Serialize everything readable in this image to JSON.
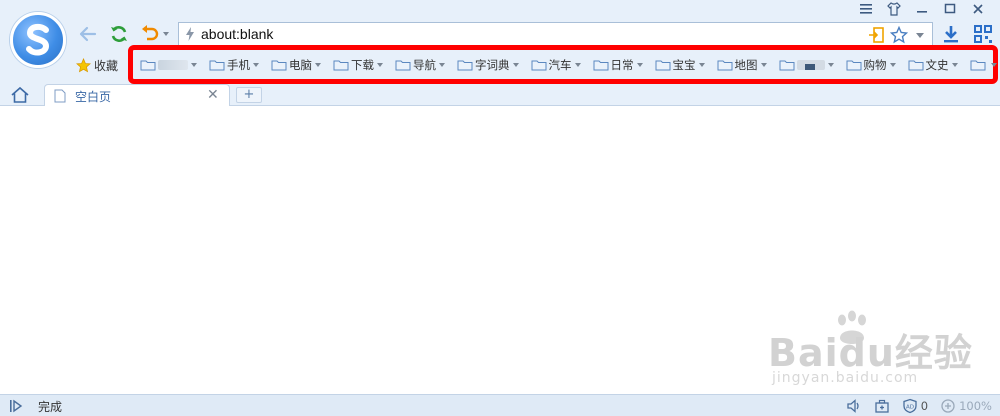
{
  "window": {
    "buttons": [
      {
        "name": "menu-icon"
      },
      {
        "name": "skin-icon"
      },
      {
        "name": "minimize-icon"
      },
      {
        "name": "maximize-icon"
      },
      {
        "name": "close-icon"
      }
    ]
  },
  "address_bar": {
    "url": "about:blank"
  },
  "favorites": {
    "label": "收藏",
    "folders": [
      {
        "label": "",
        "blurred": true
      },
      {
        "label": "手机"
      },
      {
        "label": "电脑"
      },
      {
        "label": "下载"
      },
      {
        "label": "导航"
      },
      {
        "label": "字词典"
      },
      {
        "label": "汽车"
      },
      {
        "label": "日常"
      },
      {
        "label": "宝宝"
      },
      {
        "label": "地图"
      },
      {
        "label": "",
        "blurred": true
      },
      {
        "label": "购物"
      },
      {
        "label": "文史"
      },
      {
        "label": ""
      }
    ]
  },
  "tabs": [
    {
      "title": "空白页",
      "active": true
    }
  ],
  "status": {
    "text": "完成",
    "blocked_count": "0",
    "zoom": "100%"
  },
  "watermark": {
    "brand": "Baidu经验",
    "url": "jingyan.baidu.com"
  },
  "colors": {
    "chrome_bg": "#e7f0fa",
    "highlight_border": "#ff0000",
    "accent": "#3f8de6",
    "refresh_green": "#2e9e3a",
    "undo_orange": "#f08a00"
  }
}
